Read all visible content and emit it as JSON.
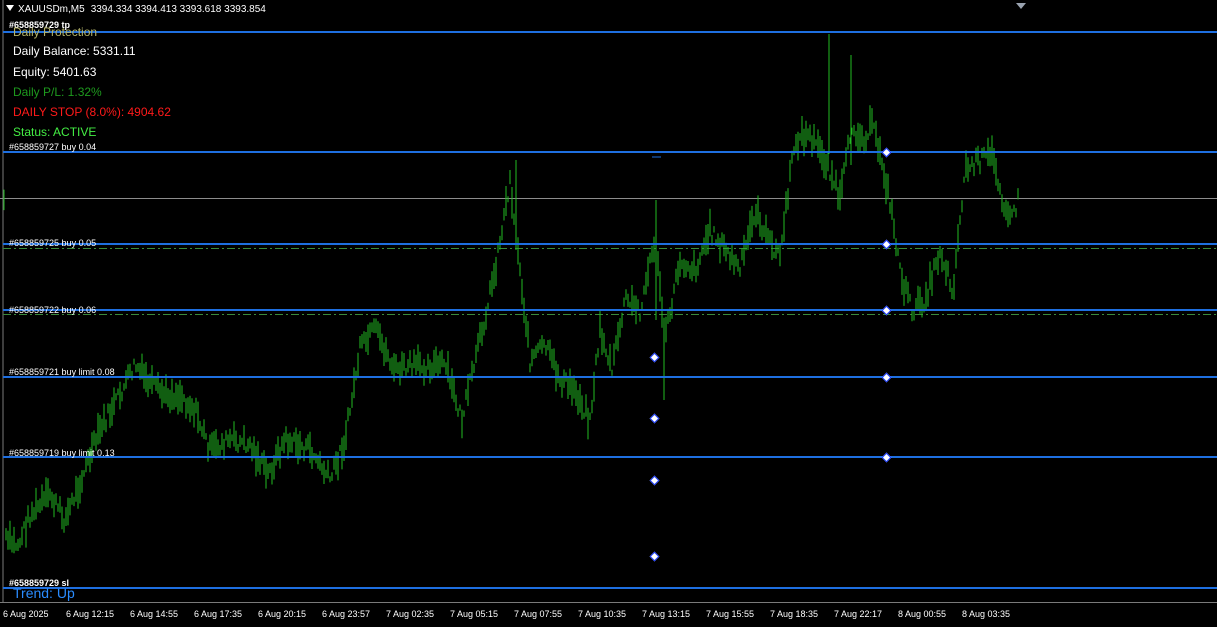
{
  "header": {
    "symbol": "XAUUSDm,M5",
    "quotes": "3394.334 3394.413 3393.618 3393.854"
  },
  "panel": {
    "tp_label": "#658859729 tp",
    "title": "Daily Protection",
    "balance": "Daily Balance: 5331.11",
    "equity": "Equity: 5401.63",
    "pl": "Daily P/L: 1.32%",
    "stop": "DAILY STOP (8.0%): 4904.62",
    "status": "Status: ACTIVE",
    "sl_label": "#658859729 sl",
    "trend": "Trend: Up"
  },
  "orders": [
    {
      "label": "#658859727 buy 0.04"
    },
    {
      "label": "#658859725 buy 0.05"
    },
    {
      "label": "#658859722 buy 0.06"
    },
    {
      "label": "#658859721 buy limit 0.08"
    },
    {
      "label": "#658859719 buy limit 0.13"
    }
  ],
  "time_axis": [
    "6 Aug 2025",
    "6 Aug 12:15",
    "6 Aug 14:55",
    "6 Aug 17:35",
    "6 Aug 20:15",
    "6 Aug 23:57",
    "7 Aug 02:35",
    "7 Aug 05:15",
    "7 Aug 07:55",
    "7 Aug 10:35",
    "7 Aug 13:15",
    "7 Aug 15:55",
    "7 Aug 18:35",
    "7 Aug 22:17",
    "8 Aug 00:55",
    "8 Aug 03:35"
  ],
  "colors": {
    "background": "#000000",
    "bars": "#22bb22",
    "order_line": "#1e6fe0",
    "pl_text": "#1e9a1e",
    "stop_text": "#ff1a1a",
    "status_text": "#44ee44",
    "trend_text": "#2a8cff",
    "title_text": "#b5b56a"
  },
  "chart_data": {
    "type": "ohlc",
    "title": "XAUUSDm,M5",
    "x": [
      "6 Aug 2025",
      "6 Aug 12:15",
      "6 Aug 14:55",
      "6 Aug 17:35",
      "6 Aug 20:15",
      "6 Aug 23:57",
      "7 Aug 02:35",
      "7 Aug 05:15",
      "7 Aug 07:55",
      "7 Aug 10:35",
      "7 Aug 13:15",
      "7 Aug 15:55",
      "7 Aug 18:35",
      "7 Aug 22:17",
      "8 Aug 00:55",
      "8 Aug 03:35"
    ],
    "last_bar": {
      "open": 3394.334,
      "high": 3394.413,
      "low": 3393.618,
      "close": 3393.854
    },
    "grid": false,
    "legend": "none"
  }
}
